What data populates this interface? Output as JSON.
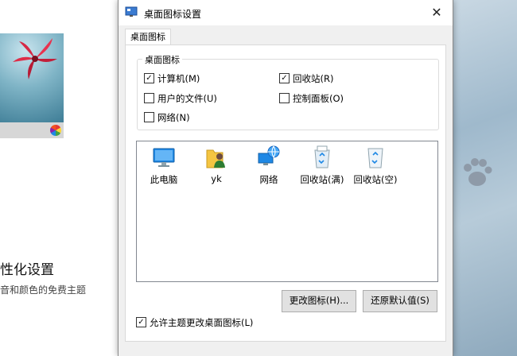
{
  "background": {
    "left_title": "性化设置",
    "left_subtitle": "音和颜色的免费主题"
  },
  "dialog": {
    "title": "桌面图标设置",
    "close_glyph": "✕",
    "tab_label": "桌面图标",
    "group_label": "桌面图标",
    "checkboxes": [
      {
        "label": "计算机(M)",
        "checked": true
      },
      {
        "label": "回收站(R)",
        "checked": true
      },
      {
        "label": "用户的文件(U)",
        "checked": false
      },
      {
        "label": "控制面板(O)",
        "checked": false
      },
      {
        "label": "网络(N)",
        "checked": false
      }
    ],
    "icons": [
      {
        "label": "此电脑",
        "icon": "this-pc-icon"
      },
      {
        "label": "yk",
        "icon": "user-folder-icon"
      },
      {
        "label": "网络",
        "icon": "network-icon"
      },
      {
        "label": "回收站(满)",
        "icon": "recycle-bin-full-icon"
      },
      {
        "label": "回收站(空)",
        "icon": "recycle-bin-empty-icon"
      }
    ],
    "change_icon_button": "更改图标(H)...",
    "restore_default_button": "还原默认值(S)",
    "allow_themes": {
      "label": "允许主题更改桌面图标(L)",
      "checked": true
    }
  },
  "colors": {
    "dialog_bg": "#f0f0f0",
    "panel_bg": "#ffffff",
    "button_bg": "#e1e1e1",
    "accent_blue": "#1e88e5"
  }
}
